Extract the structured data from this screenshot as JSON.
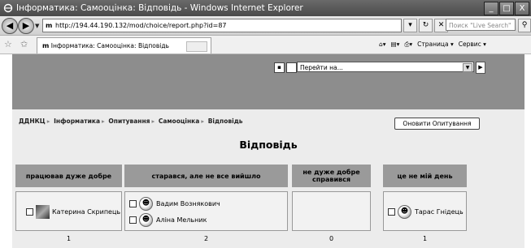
{
  "window": {
    "title": "Інформатика: Самооцінка: Відповідь - Windows Internet Explorer",
    "controls": [
      "_",
      "□",
      "X"
    ]
  },
  "addressbar": {
    "back_icon": "back-arrow-icon",
    "forward_icon": "forward-arrow-icon",
    "url": "http://194.44.190.132/mod/choice/report.php?id=87",
    "search_placeholder": "Поиск \"Live Search\""
  },
  "tabs": {
    "active_tab": "Інформатика: Самооцінка: Відповідь",
    "tools": [
      "Страница ▾",
      "Сервис ▾"
    ]
  },
  "moodle_header": {
    "jump_label": "Перейти на..."
  },
  "breadcrumb": [
    "ДДНКЦ",
    "Інформатика",
    "Опитування",
    "Самооцінка",
    "Відповідь"
  ],
  "view_button_label": "Оновити Опитування",
  "page_heading": "Відповідь",
  "choices": [
    {
      "label": "працював дуже добре",
      "users": [
        "Катерина Скрипець"
      ],
      "count": "1"
    },
    {
      "label": "старався, але не все вийшло",
      "users": [
        "Вадим Вознякович",
        "Аліна Мельник"
      ],
      "count": "2"
    },
    {
      "label": "не дуже добре справився",
      "users": [],
      "count": "0"
    },
    {
      "label": "це не мій день",
      "users": [
        "Тарас Гнідець"
      ],
      "count": "1"
    }
  ]
}
